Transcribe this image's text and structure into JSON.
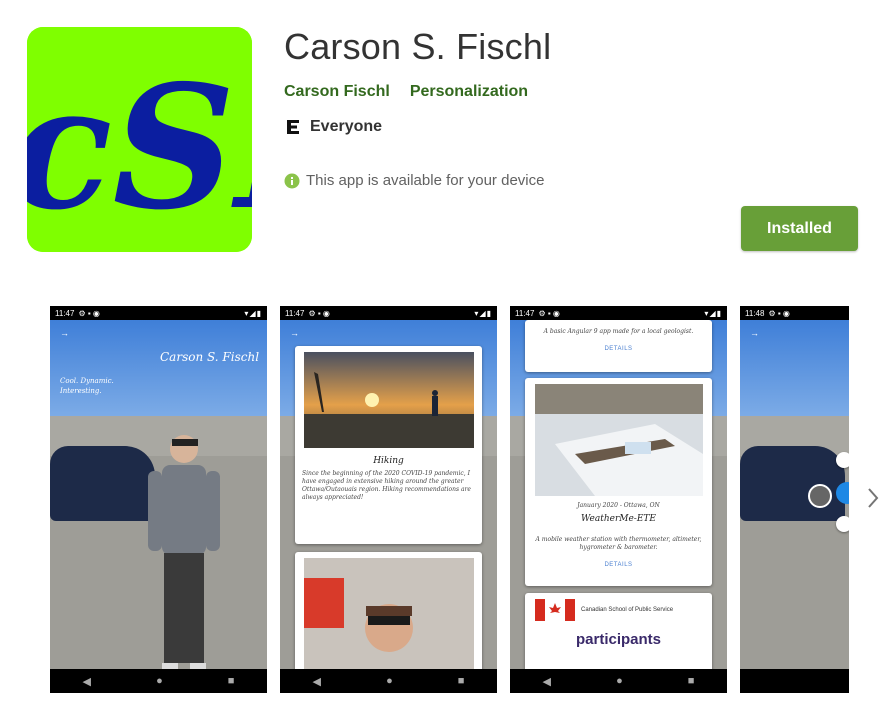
{
  "app": {
    "title": "Carson S. Fischl",
    "developer": "Carson Fischl",
    "category": "Personalization",
    "rating_label": "Everyone",
    "availability": "This app is available for your device",
    "install_button": "Installed",
    "icon_text": "cSF",
    "icon_bg": "#7fff00",
    "icon_fg": "#0b1ea0"
  },
  "screenshots": [
    {
      "time": "11:47",
      "heading": "Carson S. Fischl",
      "tagline": "Cool. Dynamic. Interesting."
    },
    {
      "time": "11:47",
      "card_title": "Hiking",
      "card_text": "Since the beginning of the 2020 COVID-19 pandemic, I have engaged in extensive hiking around the greater Ottawa/Outaouais region. Hiking recommendations are always appreciated!"
    },
    {
      "time": "11:47",
      "top_text": "A basic Angular 9 app made for a local geologist.",
      "link": "DETAILS",
      "card_date": "January 2020 - Ottawa, ON",
      "card_title": "WeatherMe-ETE",
      "card_text": "A mobile weather station with thermometer, altimeter, hygrometer & barometer.",
      "card_link": "DETAILS",
      "logo_text": "Canadian School of Public Service",
      "word_cloud": "participants"
    },
    {
      "time": "11:48"
    }
  ],
  "colors": {
    "accent_green": "#689f38",
    "link_green": "#33691e",
    "info_green": "#8bc34a"
  }
}
